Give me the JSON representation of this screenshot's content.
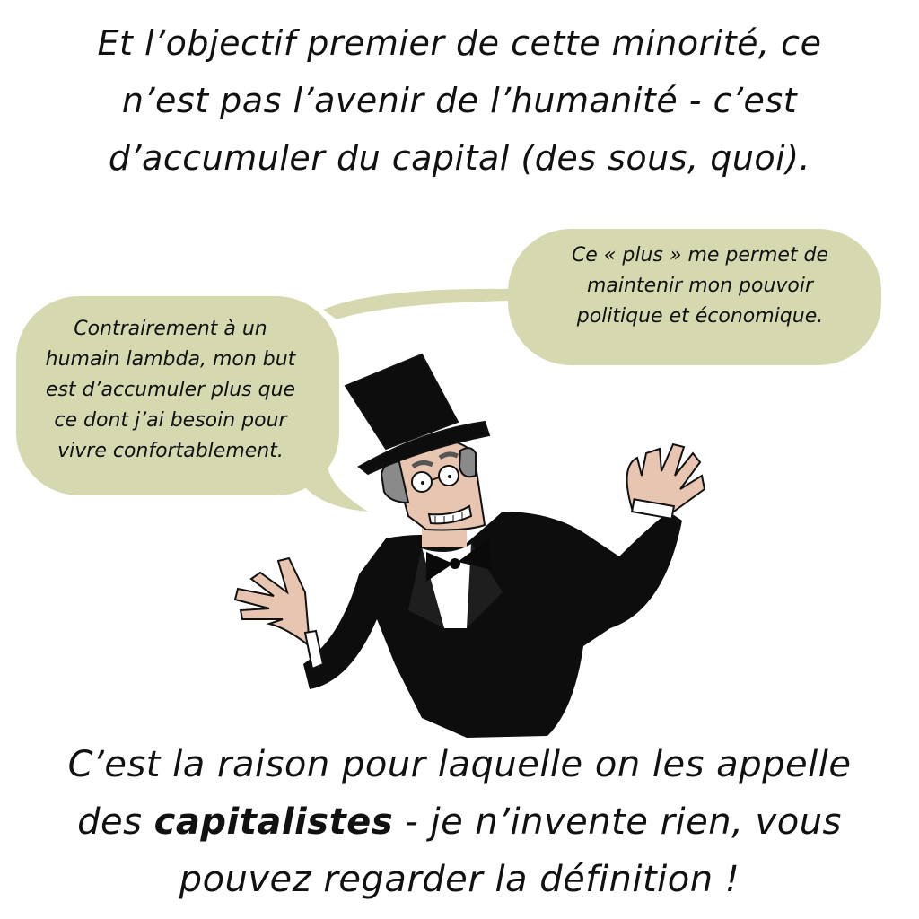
{
  "top_caption": {
    "line1": "Et l’objectif premier de cette minorité, ce",
    "line2": "n’est pas l’avenir de l’humanité - c’est",
    "line3": "d’accumuler du capital (des sous, quoi)."
  },
  "bubble_left": {
    "line1": "Contrairement à un",
    "line2": "humain lambda, mon but",
    "line3": "est d’accumuler plus que",
    "line4": "ce dont j’ai besoin pour",
    "line5": "vivre confortablement."
  },
  "bubble_right": {
    "line1": "Ce « plus » me permet de",
    "line2": "maintenir mon pouvoir",
    "line3": "politique et économique."
  },
  "bottom_caption": {
    "line1": "C’est la raison pour laquelle on les appelle",
    "line2_prefix": "des ",
    "line2_bold": "capitalistes",
    "line2_suffix": " - je n’invente rien, vous",
    "line3": "pouvez regarder la définition !"
  },
  "colors": {
    "bubble_fill": "#d6d9b0",
    "suit": "#0d0d0d",
    "skin": "#e8c5b0",
    "hair": "#8a8a8a"
  }
}
